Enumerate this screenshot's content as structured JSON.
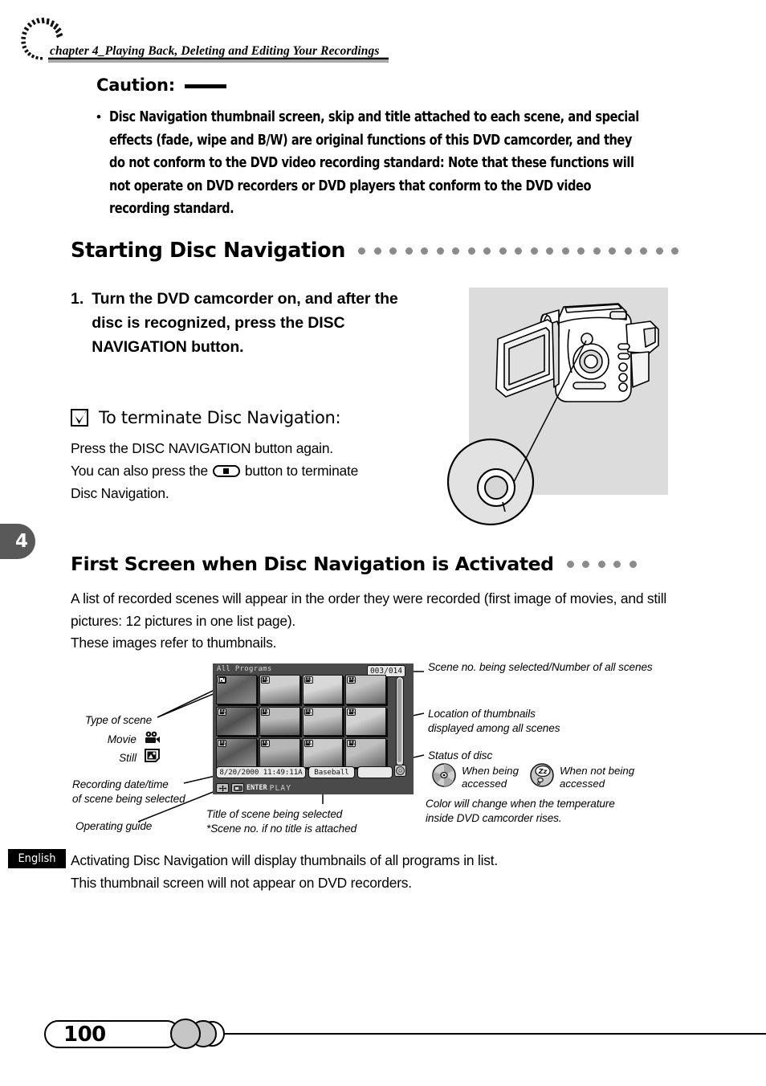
{
  "header": {
    "chapter": "chapter 4_Playing Back, Deleting and Editing Your Recordings",
    "logo_icon": "dashed-spiral-logo"
  },
  "caution": {
    "title": "Caution:",
    "bullet": "•",
    "text": "Disc Navigation thumbnail screen, skip and title attached to each scene, and special effects (fade, wipe and B/W) are original functions of this DVD camcorder, and they do not conform to the DVD video recording standard: Note that these functions will not operate on DVD recorders or DVD players that conform to the DVD video recording standard."
  },
  "section_starting": {
    "title": "Starting Disc Navigation",
    "dot_count": 21,
    "dot_color": "#8b8b8b"
  },
  "step1": {
    "number": "1.",
    "text": "Turn the DVD camcorder on, and after the disc is recognized, press the DISC NAVIGATION button."
  },
  "terminate": {
    "checkbox_icon": "checkbox-checked-icon",
    "title": "To terminate Disc Navigation:",
    "line1": "Press the DISC NAVIGATION button again.",
    "line2_before": "You can also press the",
    "button_icon": "pill-button-icon",
    "line2_after": "button to terminate",
    "line3": "Disc Navigation."
  },
  "figure": {
    "camcorder_icon": "dvd-camcorder-illustration",
    "callout_icon": "disc-navigation-button-magnifier"
  },
  "chapter_tab": {
    "number": "4"
  },
  "section_first": {
    "title": "First Screen when Disc Navigation is Activated",
    "dot_count": 5,
    "dot_color": "#8b8b8b"
  },
  "first_intro": {
    "line1": "A list of recorded scenes will appear in the order they were recorded (first image of movies, and still pictures: 12 pictures in one list page).",
    "line2": "These images refer to thumbnails."
  },
  "lcd": {
    "screen_title": "All Programs",
    "counter": "003/014",
    "datetime": "8/20/2000 11:49:11A",
    "scene_title": "Baseball",
    "guide_enter": "ENTER",
    "guide_play": "PLAY",
    "scrollbar_icon": "vertical-scrollbar",
    "disc_status_icon": "disc-status-icon",
    "thumbnails": [
      {
        "type": "still",
        "icon": "still-badge-icon"
      },
      {
        "type": "movie",
        "icon": "movie-badge-icon"
      },
      {
        "type": "movie",
        "icon": "movie-badge-icon"
      },
      {
        "type": "movie",
        "icon": "movie-badge-icon"
      },
      {
        "type": "movie",
        "icon": "movie-badge-icon"
      },
      {
        "type": "movie",
        "icon": "movie-badge-icon"
      },
      {
        "type": "movie",
        "icon": "movie-badge-icon"
      },
      {
        "type": "movie",
        "icon": "movie-badge-icon"
      },
      {
        "type": "movie",
        "icon": "movie-badge-icon"
      },
      {
        "type": "movie",
        "icon": "movie-badge-icon"
      },
      {
        "type": "movie",
        "icon": "movie-badge-icon"
      },
      {
        "type": "movie",
        "icon": "movie-badge-icon"
      }
    ]
  },
  "annotations": {
    "type_of_scene": "Type of scene",
    "movie_label": "Movie",
    "movie_icon": "movie-camera-icon",
    "still_label": "Still",
    "still_icon": "still-picture-icon",
    "recording_datetime_l1": "Recording date/time",
    "recording_datetime_l2": "of scene being selected",
    "operating_guide": "Operating guide",
    "scene_title_l1": "Title of scene being selected",
    "scene_title_l2": "*Scene no. if no title is attached",
    "scene_no": "Scene no. being selected/Number of all scenes",
    "location_l1": "Location of thumbnails",
    "location_l2": "displayed among all scenes",
    "status_of_disc": "Status of disc",
    "disc_accessed_icon": "disc-spinning-icon",
    "disc_accessed_l1": "When being",
    "disc_accessed_l2": "accessed",
    "disc_idle_icon": "disc-sleeping-zz-icon",
    "disc_idle_l1": "When not being",
    "disc_idle_l2": "accessed",
    "color_note_l1": "Color will change when the temperature",
    "color_note_l2": "inside DVD camcorder rises."
  },
  "bottom": {
    "language_badge": "English",
    "line1": "Activating Disc Navigation will display thumbnails of all programs in list.",
    "line2": "This thumbnail screen will not appear on DVD recorders."
  },
  "footer": {
    "page_number": "100"
  }
}
